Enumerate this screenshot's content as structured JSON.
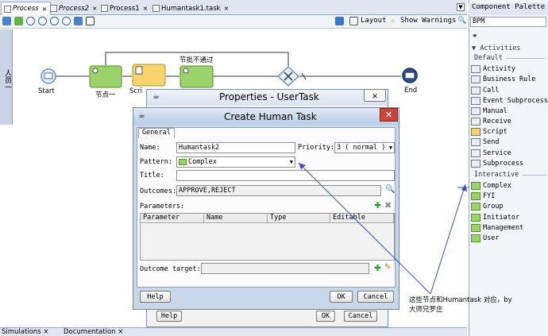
{
  "editor_tabs": [
    {
      "label": "Process",
      "active": true
    },
    {
      "label": "Process2",
      "active": false
    },
    {
      "label": "Process1",
      "active": false
    },
    {
      "label": "Humantask1.task",
      "active": false
    }
  ],
  "toolbar": {
    "layout_label": "Layout",
    "show_warnings_label": "Show Warnings"
  },
  "lane": {
    "label": "人员一"
  },
  "process": {
    "start_label": "Start",
    "node1_label": "节点一",
    "script_label": "Scri",
    "node2_label": "节批不通过",
    "end_label": "End"
  },
  "palette": {
    "title": "Component Palette",
    "selected": "BPM",
    "activities_header": "Activities",
    "default_header": "Default",
    "default_items": [
      "Activity",
      "Business Rule",
      "Call",
      "Event Subprocess",
      "Manual",
      "Receive",
      "Script",
      "Send",
      "Service",
      "Subprocess"
    ],
    "interactive_header": "Interactive",
    "interactive_items": [
      "Complex",
      "FYI",
      "Group",
      "Initiator",
      "Management",
      "User"
    ]
  },
  "bottom_tabs": [
    "Simulations",
    "Documentation"
  ],
  "properties_dialog": {
    "title": "Properties - UserTask",
    "help": "Help",
    "ok": "OK",
    "cancel": "Cancel"
  },
  "create_dialog": {
    "title": "Create Human Task",
    "tab": "General",
    "name_label": "Name:",
    "name_value": "Humantask2",
    "priority_label": "Priority:",
    "priority_value": "3 ( normal )",
    "pattern_label": "Pattern:",
    "pattern_value": "Complex",
    "title_label": "Title:",
    "title_value": "",
    "outcomes_label": "Outcomes:",
    "outcomes_value": "APPROVE,REJECT",
    "parameters_label": "Parameters:",
    "columns": [
      "Parameter",
      "Name",
      "Type",
      "Editable"
    ],
    "outcome_target_label": "Outcome target:",
    "help": "Help",
    "ok": "OK",
    "cancel": "Cancel"
  },
  "annotation": {
    "line1": "这些节点和Humantask 对应，by",
    "line2": "大师兄罗庄"
  }
}
